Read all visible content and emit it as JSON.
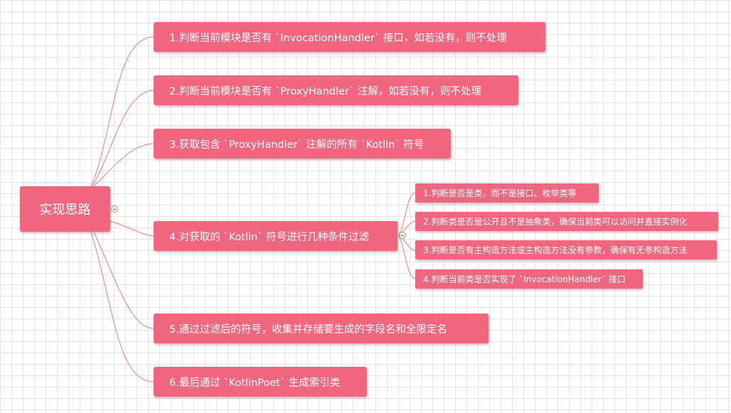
{
  "root": {
    "label": "实现思路"
  },
  "steps": [
    {
      "label": "1.判断当前模块是否有 `InvocationHandler` 接口，如若没有，则不处理"
    },
    {
      "label": "2.判断当前模块是否有 `ProxyHandler` 注解，如若没有，则不处理"
    },
    {
      "label": "3.获取包含 `ProxyHandler` 注解的所有 `Kotlin` 符号"
    },
    {
      "label": "4.对获取的 `Kotlin` 符号进行几种条件过滤",
      "children": [
        {
          "label": "1.判断是否是类，而不是接口、枚举类等"
        },
        {
          "label": "2.判断类是否是公开且不是抽象类，确保当前类可以访问并直接实例化"
        },
        {
          "label": "3.判断是否有主构造方法或主构造方法没有参数，确保有无参构造方法"
        },
        {
          "label": "4.判断当前类是否实现了 `InvocationHandler` 接口"
        }
      ]
    },
    {
      "label": "5.通过过滤后的符号，收集并存储要生成的字段名和全限定名"
    },
    {
      "label": "6.最后通过 `KotlinPoet` 生成索引类"
    }
  ],
  "colors": {
    "node_fill": "#f0667f",
    "connector": "#e8788c",
    "text": "#ffffff"
  }
}
